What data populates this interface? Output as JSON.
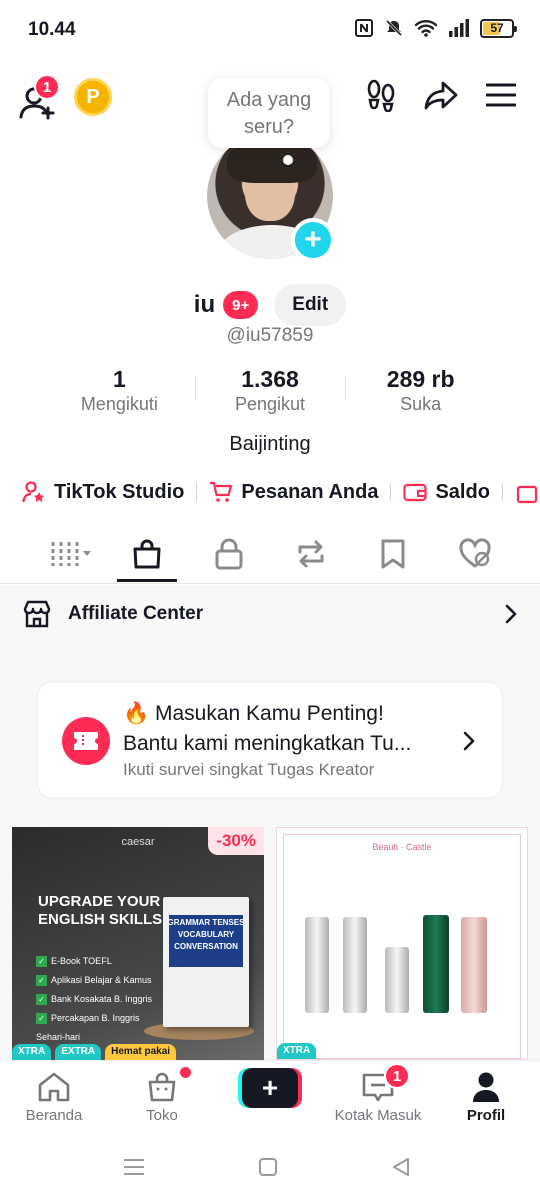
{
  "status_bar": {
    "time": "10.44",
    "battery": "57"
  },
  "header": {
    "friend_badge": "1",
    "coin_label": "P"
  },
  "profile": {
    "bubble_text": "Ada yang seru?",
    "display_name": "iu",
    "name_badge": "9+",
    "edit_label": "Edit",
    "username": "@iu57859",
    "stats": [
      {
        "value": "1",
        "label": "Mengikuti"
      },
      {
        "value": "1.368",
        "label": "Pengikut"
      },
      {
        "value": "289 rb",
        "label": "Suka"
      }
    ],
    "bio": "Baijinting"
  },
  "shortcuts": [
    {
      "label": "TikTok Studio",
      "icon": "person-star-icon"
    },
    {
      "label": "Pesanan Anda",
      "icon": "cart-icon"
    },
    {
      "label": "Saldo",
      "icon": "wallet-icon"
    }
  ],
  "tabs": [
    "grid",
    "shop",
    "private",
    "repost",
    "favorites",
    "liked"
  ],
  "active_tab": "shop",
  "affiliate": {
    "label": "Affiliate Center"
  },
  "survey": {
    "title": "🔥 Masukan Kamu Penting!",
    "line2": "Bantu kami meningkatkan Tu...",
    "subtitle": "Ikuti survei singkat Tugas Kreator"
  },
  "products": [
    {
      "discount": "-30%",
      "brand": "caesar",
      "headline": "UPGRADE YOUR ENGLISH SKILLS",
      "features": [
        "E-Book TOEFL",
        "Aplikasi Belajar & Kamus",
        "Bank Kosakata B. Inggris",
        "Percakapan B. Inggris Sehari-hari"
      ],
      "book_text": "GRAMMAR TENSES VOCABULARY CONVERSATION",
      "tags": [
        "XTRA",
        "EXTRA",
        "Hemat pakai"
      ]
    },
    {
      "brand": "Beauti · Castle",
      "tags": [
        "XTRA"
      ]
    }
  ],
  "bottom_nav": [
    {
      "label": "Beranda",
      "icon": "home-icon"
    },
    {
      "label": "Toko",
      "icon": "shop-icon"
    },
    {
      "label": "",
      "icon": "create-icon"
    },
    {
      "label": "Kotak Masuk",
      "icon": "inbox-icon",
      "badge": "1"
    },
    {
      "label": "Profil",
      "icon": "profile-icon"
    }
  ],
  "colors": {
    "accent": "#fe2c55",
    "cyan": "#25f4ee",
    "text": "#161823",
    "muted": "#75767c"
  }
}
